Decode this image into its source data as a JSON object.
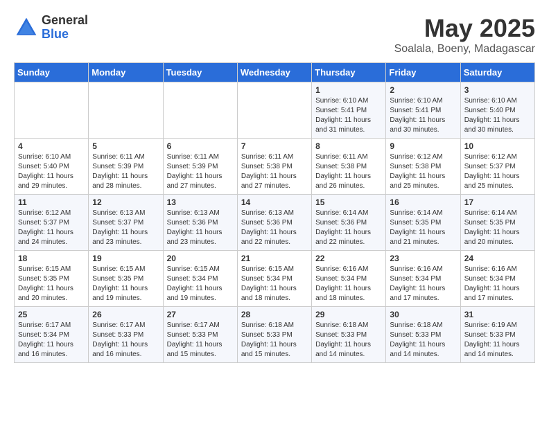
{
  "header": {
    "logo_general": "General",
    "logo_blue": "Blue",
    "month_year": "May 2025",
    "location": "Soalala, Boeny, Madagascar"
  },
  "days_of_week": [
    "Sunday",
    "Monday",
    "Tuesday",
    "Wednesday",
    "Thursday",
    "Friday",
    "Saturday"
  ],
  "weeks": [
    [
      {
        "day": "",
        "info": ""
      },
      {
        "day": "",
        "info": ""
      },
      {
        "day": "",
        "info": ""
      },
      {
        "day": "",
        "info": ""
      },
      {
        "day": "1",
        "info": "Sunrise: 6:10 AM\nSunset: 5:41 PM\nDaylight: 11 hours\nand 31 minutes."
      },
      {
        "day": "2",
        "info": "Sunrise: 6:10 AM\nSunset: 5:41 PM\nDaylight: 11 hours\nand 30 minutes."
      },
      {
        "day": "3",
        "info": "Sunrise: 6:10 AM\nSunset: 5:40 PM\nDaylight: 11 hours\nand 30 minutes."
      }
    ],
    [
      {
        "day": "4",
        "info": "Sunrise: 6:10 AM\nSunset: 5:40 PM\nDaylight: 11 hours\nand 29 minutes."
      },
      {
        "day": "5",
        "info": "Sunrise: 6:11 AM\nSunset: 5:39 PM\nDaylight: 11 hours\nand 28 minutes."
      },
      {
        "day": "6",
        "info": "Sunrise: 6:11 AM\nSunset: 5:39 PM\nDaylight: 11 hours\nand 27 minutes."
      },
      {
        "day": "7",
        "info": "Sunrise: 6:11 AM\nSunset: 5:38 PM\nDaylight: 11 hours\nand 27 minutes."
      },
      {
        "day": "8",
        "info": "Sunrise: 6:11 AM\nSunset: 5:38 PM\nDaylight: 11 hours\nand 26 minutes."
      },
      {
        "day": "9",
        "info": "Sunrise: 6:12 AM\nSunset: 5:38 PM\nDaylight: 11 hours\nand 25 minutes."
      },
      {
        "day": "10",
        "info": "Sunrise: 6:12 AM\nSunset: 5:37 PM\nDaylight: 11 hours\nand 25 minutes."
      }
    ],
    [
      {
        "day": "11",
        "info": "Sunrise: 6:12 AM\nSunset: 5:37 PM\nDaylight: 11 hours\nand 24 minutes."
      },
      {
        "day": "12",
        "info": "Sunrise: 6:13 AM\nSunset: 5:37 PM\nDaylight: 11 hours\nand 23 minutes."
      },
      {
        "day": "13",
        "info": "Sunrise: 6:13 AM\nSunset: 5:36 PM\nDaylight: 11 hours\nand 23 minutes."
      },
      {
        "day": "14",
        "info": "Sunrise: 6:13 AM\nSunset: 5:36 PM\nDaylight: 11 hours\nand 22 minutes."
      },
      {
        "day": "15",
        "info": "Sunrise: 6:14 AM\nSunset: 5:36 PM\nDaylight: 11 hours\nand 22 minutes."
      },
      {
        "day": "16",
        "info": "Sunrise: 6:14 AM\nSunset: 5:35 PM\nDaylight: 11 hours\nand 21 minutes."
      },
      {
        "day": "17",
        "info": "Sunrise: 6:14 AM\nSunset: 5:35 PM\nDaylight: 11 hours\nand 20 minutes."
      }
    ],
    [
      {
        "day": "18",
        "info": "Sunrise: 6:15 AM\nSunset: 5:35 PM\nDaylight: 11 hours\nand 20 minutes."
      },
      {
        "day": "19",
        "info": "Sunrise: 6:15 AM\nSunset: 5:35 PM\nDaylight: 11 hours\nand 19 minutes."
      },
      {
        "day": "20",
        "info": "Sunrise: 6:15 AM\nSunset: 5:34 PM\nDaylight: 11 hours\nand 19 minutes."
      },
      {
        "day": "21",
        "info": "Sunrise: 6:15 AM\nSunset: 5:34 PM\nDaylight: 11 hours\nand 18 minutes."
      },
      {
        "day": "22",
        "info": "Sunrise: 6:16 AM\nSunset: 5:34 PM\nDaylight: 11 hours\nand 18 minutes."
      },
      {
        "day": "23",
        "info": "Sunrise: 6:16 AM\nSunset: 5:34 PM\nDaylight: 11 hours\nand 17 minutes."
      },
      {
        "day": "24",
        "info": "Sunrise: 6:16 AM\nSunset: 5:34 PM\nDaylight: 11 hours\nand 17 minutes."
      }
    ],
    [
      {
        "day": "25",
        "info": "Sunrise: 6:17 AM\nSunset: 5:34 PM\nDaylight: 11 hours\nand 16 minutes."
      },
      {
        "day": "26",
        "info": "Sunrise: 6:17 AM\nSunset: 5:33 PM\nDaylight: 11 hours\nand 16 minutes."
      },
      {
        "day": "27",
        "info": "Sunrise: 6:17 AM\nSunset: 5:33 PM\nDaylight: 11 hours\nand 15 minutes."
      },
      {
        "day": "28",
        "info": "Sunrise: 6:18 AM\nSunset: 5:33 PM\nDaylight: 11 hours\nand 15 minutes."
      },
      {
        "day": "29",
        "info": "Sunrise: 6:18 AM\nSunset: 5:33 PM\nDaylight: 11 hours\nand 14 minutes."
      },
      {
        "day": "30",
        "info": "Sunrise: 6:18 AM\nSunset: 5:33 PM\nDaylight: 11 hours\nand 14 minutes."
      },
      {
        "day": "31",
        "info": "Sunrise: 6:19 AM\nSunset: 5:33 PM\nDaylight: 11 hours\nand 14 minutes."
      }
    ]
  ]
}
